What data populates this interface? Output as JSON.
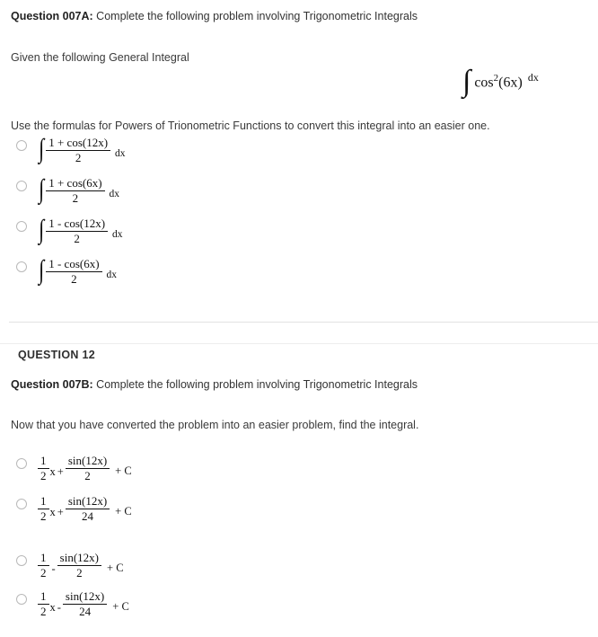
{
  "questions": [
    {
      "id": "007A",
      "header_label": "Question 007A:",
      "header_text": "Complete the following problem involving Trigonometric Integrals",
      "prompt": "Given the following General Integral",
      "displayed_integral": {
        "integral_symbol": "∫",
        "function": "cos",
        "exponent": "2",
        "argument": "(6x)",
        "differential": "dx",
        "plain": "∫ cos²(6x) dx"
      },
      "instruction": "Use the formulas for Powers of Trionometric Functions to convert this integral into an easier one.",
      "options": [
        {
          "integral_symbol": "∫",
          "numerator": "1 + cos(12x)",
          "denominator": "2",
          "differential": "dx",
          "selected": false
        },
        {
          "integral_symbol": "∫",
          "numerator": "1 + cos(6x)",
          "denominator": "2",
          "differential": "dx",
          "selected": false
        },
        {
          "integral_symbol": "∫",
          "numerator": "1 - cos(12x)",
          "denominator": "2",
          "differential": "dx",
          "selected": false
        },
        {
          "integral_symbol": "∫",
          "numerator": "1 - cos(6x)",
          "denominator": "2",
          "differential": "dx",
          "selected": false
        }
      ]
    }
  ],
  "section": {
    "title": "QUESTION 12"
  },
  "question_b": {
    "id": "007B",
    "header_label": "Question 007B:",
    "header_text": "Complete the following problem involving Trigonometric Integrals",
    "prompt": "Now that you have converted the problem into an easier problem, find the integral.",
    "options": [
      {
        "lead_num": "1",
        "lead_den": "2",
        "lead_var": "x",
        "operator": "+",
        "numerator": "sin(12x)",
        "denominator": "2",
        "constant": "+ C",
        "selected": false
      },
      {
        "lead_num": "1",
        "lead_den": "2",
        "lead_var": "x",
        "operator": "+",
        "numerator": "sin(12x)",
        "denominator": "24",
        "constant": "+ C",
        "selected": false
      },
      {
        "lead_num": "1",
        "lead_den": "2",
        "lead_var": "",
        "operator": "-",
        "numerator": "sin(12x)",
        "denominator": "2",
        "constant": "+ C",
        "selected": false
      },
      {
        "lead_num": "1",
        "lead_den": "2",
        "lead_var": "x",
        "operator": "-",
        "numerator": "sin(12x)",
        "denominator": "24",
        "constant": "+ C",
        "selected": false
      }
    ]
  },
  "colors": {
    "background": "#ffffff",
    "text": "#333333",
    "heading": "#222222",
    "divider": "#e2e2e2",
    "radio_border": "#b9b9b9"
  }
}
